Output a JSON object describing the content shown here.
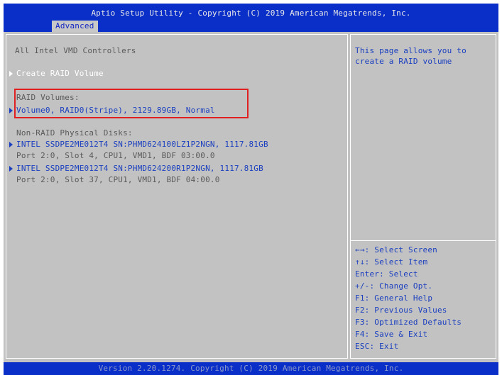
{
  "header": {
    "title": "Aptio Setup Utility - Copyright (C) 2019 American Megatrends, Inc.",
    "active_tab": "Advanced"
  },
  "main": {
    "heading": "All Intel VMD Controllers",
    "create_raid": "Create RAID Volume",
    "raid_volumes_label": "RAID Volumes:",
    "volume0": "Volume0, RAID0(Stripe), 2129.89GB, Normal",
    "non_raid_label": "Non-RAID Physical Disks:",
    "disks": [
      {
        "name": "INTEL SSDPE2ME012T4 SN:PHMD624100LZ1P2NGN, 1117.81GB",
        "location": "Port  2:0, Slot   4, CPU1, VMD1, BDF 03:00.0"
      },
      {
        "name": "INTEL SSDPE2ME012T4 SN:PHMD624200R1P2NGN, 1117.81GB",
        "location": "Port  2:0, Slot  37, CPU1, VMD1, BDF 04:00.0"
      }
    ]
  },
  "help": {
    "line1": "This page allows you to",
    "line2": "create a RAID volume"
  },
  "keys": [
    "←→: Select Screen",
    "↑↓: Select Item",
    "Enter: Select",
    "+/-: Change Opt.",
    "F1: General Help",
    "F2: Previous Values",
    "F3: Optimized Defaults",
    "F4: Save & Exit",
    "ESC: Exit"
  ],
  "footer": {
    "version": "Version 2.20.1274. Copyright (C) 2019 American Megatrends, Inc."
  },
  "colors": {
    "header_bg": "#0a2fc8",
    "panel_bg": "#c2c2c2",
    "link_blue": "#1a3fc0",
    "highlight_red": "#e02020"
  }
}
